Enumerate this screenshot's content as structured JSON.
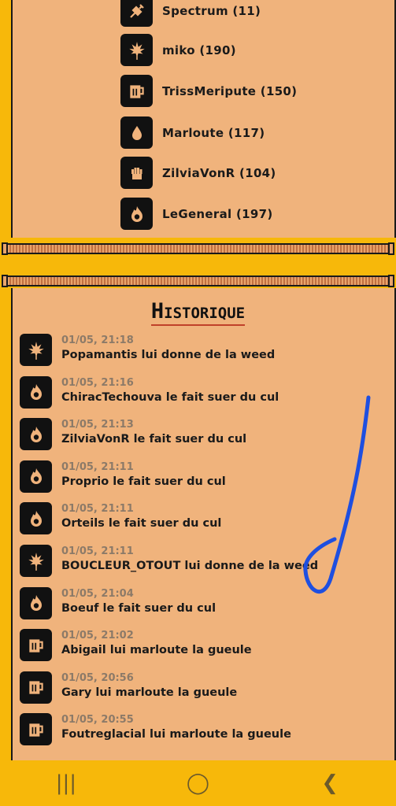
{
  "members": [
    {
      "name": "Spectrum (11)",
      "icon": "syringe-icon"
    },
    {
      "name": "miko (190)",
      "icon": "leaf-icon"
    },
    {
      "name": "TrissMeripute (150)",
      "icon": "beer-mug-icon"
    },
    {
      "name": "Marloute (117)",
      "icon": "drop-icon"
    },
    {
      "name": "ZilviaVonR (104)",
      "icon": "fist-icon"
    },
    {
      "name": "LeGeneral (197)",
      "icon": "fire-icon"
    }
  ],
  "history": {
    "title": "Historique",
    "entries": [
      {
        "time": "01/05, 21:18",
        "text": "Popamantis lui donne de la weed",
        "icon": "leaf-icon"
      },
      {
        "time": "01/05, 21:16",
        "text": "ChiracTechouva le fait suer du cul",
        "icon": "fire-icon"
      },
      {
        "time": "01/05, 21:13",
        "text": "ZilviaVonR le fait suer du cul",
        "icon": "fire-icon"
      },
      {
        "time": "01/05, 21:11",
        "text": "Proprio le fait suer du cul",
        "icon": "fire-icon"
      },
      {
        "time": "01/05, 21:11",
        "text": "Orteils le fait suer du cul",
        "icon": "fire-icon"
      },
      {
        "time": "01/05, 21:11",
        "text": "BOUCLEUR_OTOUT lui donne de la weed",
        "icon": "leaf-icon"
      },
      {
        "time": "01/05, 21:04",
        "text": "Boeuf le fait suer du cul",
        "icon": "fire-icon"
      },
      {
        "time": "01/05, 21:02",
        "text": "Abigail lui marloute la gueule",
        "icon": "beer-mug-icon"
      },
      {
        "time": "01/05, 20:56",
        "text": "Gary lui marloute la gueule",
        "icon": "beer-mug-icon"
      },
      {
        "time": "01/05, 20:55",
        "text": "Foutreglacial lui marloute la gueule",
        "icon": "beer-mug-icon"
      }
    ]
  },
  "navbar": {
    "recent_icon": "recent-apps-icon",
    "home_icon": "home-icon",
    "back_icon": "back-icon"
  },
  "colors": {
    "background": "#f7b80a",
    "panel": "#f0b37c",
    "annotation": "#1e4fe0"
  }
}
